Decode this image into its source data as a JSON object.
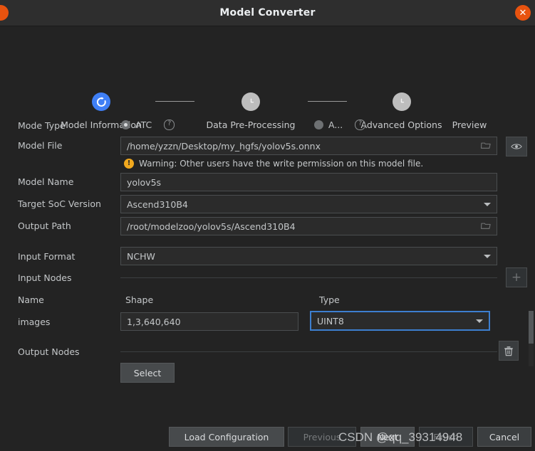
{
  "window": {
    "title": "Model Converter",
    "close_label": "✕"
  },
  "stepper": {
    "steps": [
      {
        "label": "Model Information",
        "state": "active",
        "icon": "refresh-icon"
      },
      {
        "label": "Data Pre-Processing",
        "state": "pending",
        "icon": "clock-icon"
      },
      {
        "label": "Advanced Options",
        "state": "pending",
        "icon": "clock-icon"
      },
      {
        "label": "Preview",
        "state": "pending",
        "icon": "clock-icon"
      }
    ]
  },
  "form": {
    "mode_type": {
      "label": "Mode Type",
      "options": [
        {
          "label": "ATC",
          "selected": true
        },
        {
          "label": "A...",
          "selected": false
        }
      ],
      "help_glyph": "?"
    },
    "model_file": {
      "label": "Model File",
      "value": "/home/yzzn/Desktop/my_hgfs/yolov5s.onnx",
      "browse_icon": "folder-icon",
      "preview_icon": "eye-icon"
    },
    "warning": {
      "icon_glyph": "!",
      "text": "Warning: Other users have the write permission on this model file."
    },
    "model_name": {
      "label": "Model Name",
      "value": "yolov5s"
    },
    "target_soc": {
      "label": "Target SoC Version",
      "value": "Ascend310B4"
    },
    "output_path": {
      "label": "Output Path",
      "value": "/root/modelzoo/yolov5s/Ascend310B4",
      "browse_icon": "folder-icon"
    },
    "input_format": {
      "label": "Input Format",
      "value": "NCHW"
    },
    "input_nodes": {
      "label": "Input Nodes",
      "add_label": "+",
      "columns": [
        "Name",
        "Shape",
        "Type"
      ],
      "rows": [
        {
          "name": "images",
          "shape": "1,3,640,640",
          "type": "UINT8",
          "delete_icon": "trash-icon"
        }
      ]
    },
    "output_nodes": {
      "label": "Output Nodes",
      "select_label": "Select"
    }
  },
  "footer": {
    "buttons": [
      {
        "label": "Load Configuration",
        "state": "enabled"
      },
      {
        "label": "Previous",
        "state": "disabled"
      },
      {
        "label": "Next",
        "state": "enabled"
      },
      {
        "label": "Finish",
        "state": "enabled"
      },
      {
        "label": "Cancel",
        "state": "enabled"
      }
    ]
  },
  "watermark": {
    "text": "CSDN @qq_39314948"
  },
  "colors": {
    "accent_blue": "#3f7ff5",
    "focus_blue": "#3d7fd0",
    "warning_amber": "#f0a81e",
    "close_orange": "#e8530f",
    "background": "#232323",
    "titlebar": "#2e2e2e"
  }
}
